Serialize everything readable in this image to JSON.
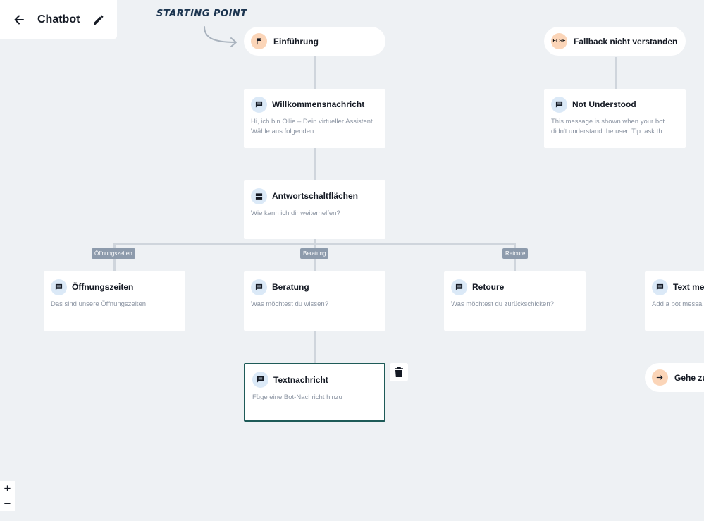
{
  "header": {
    "title": "Chatbot"
  },
  "canvas": {
    "starting_point_label": "STARTING POINT",
    "nodes": {
      "intro": {
        "title": "Einführung"
      },
      "fallback": {
        "title": "Fallback nicht verstanden",
        "badge": "ELSE"
      },
      "welcome": {
        "title": "Willkommensnachricht",
        "description": "Hi, ich bin Ollie – Dein virtueller Assistent. Wähle aus folgenden…"
      },
      "not_understood": {
        "title": "Not Understood",
        "description": "This message is shown when your bot didn't understand the user. Tip: ask th…"
      },
      "buttons": {
        "title": "Antwortschaltflächen",
        "description": "Wie kann ich dir weiterhelfen?"
      },
      "hours": {
        "title": "Öffnungszeiten",
        "description": "Das sind unsere Öffnungszeiten"
      },
      "advice": {
        "title": "Beratung",
        "description": "Was möchtest du wissen?"
      },
      "returns": {
        "title": "Retoure",
        "description": "Was möchtest du zurückschicken?"
      },
      "text_message": {
        "title": "Text mes",
        "description": "Add a bot messa"
      },
      "text_new": {
        "title": "Textnachricht",
        "description": "Füge eine Bot-Nachricht hinzu"
      },
      "goto": {
        "title": "Gehe zu"
      }
    },
    "branch_tags": [
      "Öffnungszeiten",
      "Beratung",
      "Retoure"
    ]
  },
  "zoom": {
    "in_label": "+",
    "out_label": "−"
  },
  "icons": [
    "back-arrow-icon",
    "pencil-icon",
    "flag-icon",
    "message-icon",
    "buttons-icon",
    "trash-icon",
    "arrow-right-icon"
  ],
  "colors": {
    "background": "#eef1f4",
    "accent_badge": "#fbd5b8",
    "icon_bg": "#dbe9f7",
    "selected_border": "#1e5b58",
    "tag_bg": "#8d9bac"
  }
}
